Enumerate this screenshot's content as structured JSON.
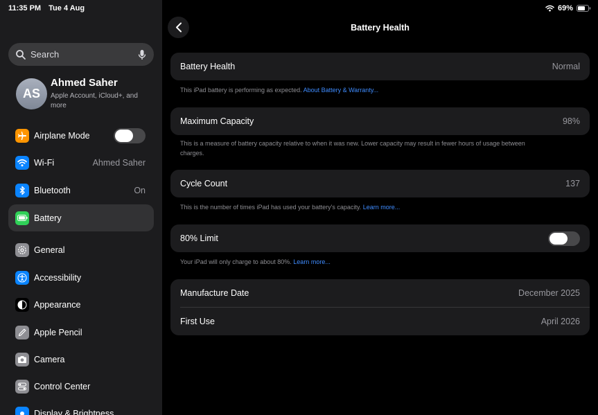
{
  "status": {
    "time": "11:35 PM",
    "date": "Tue 4 Aug",
    "battery_pct": "69%"
  },
  "search": {
    "placeholder": "Search"
  },
  "profile": {
    "initials": "AS",
    "name": "Ahmed Saher",
    "subtitle": "Apple Account, iCloud+, and more"
  },
  "sidebar": {
    "items": [
      {
        "label": "Airplane Mode",
        "icon": "airplane-icon",
        "color": "#ff9500"
      },
      {
        "label": "Wi-Fi",
        "value": "Ahmed Saher",
        "icon": "wifi-icon",
        "color": "#0a84ff"
      },
      {
        "label": "Bluetooth",
        "value": "On",
        "icon": "bluetooth-icon",
        "color": "#0a84ff"
      },
      {
        "label": "Battery",
        "icon": "battery-icon",
        "color": "#30d158"
      },
      {
        "label": "General",
        "icon": "gear-icon",
        "color": "#8e8e93"
      },
      {
        "label": "Accessibility",
        "icon": "accessibility-icon",
        "color": "#0a84ff"
      },
      {
        "label": "Appearance",
        "icon": "appearance-icon",
        "color": "#000000"
      },
      {
        "label": "Apple Pencil",
        "icon": "pencil-icon",
        "color": "#8e8e93"
      },
      {
        "label": "Camera",
        "icon": "camera-icon",
        "color": "#8e8e93"
      },
      {
        "label": "Control Center",
        "icon": "control-center-icon",
        "color": "#8e8e93"
      },
      {
        "label": "Display & Brightness",
        "icon": "display-icon",
        "color": "#0a84ff"
      }
    ]
  },
  "main": {
    "title": "Battery Health",
    "health": {
      "label": "Battery Health",
      "value": "Normal",
      "note": "This iPad battery is performing as expected.",
      "note_link": "About Battery & Warranty..."
    },
    "capacity": {
      "label": "Maximum Capacity",
      "value": "98%",
      "note": "This is a measure of battery capacity relative to when it was new. Lower capacity may result in fewer hours of usage between charges."
    },
    "cycles": {
      "label": "Cycle Count",
      "value": "137",
      "note": "This is the number of times iPad has used your battery's capacity.",
      "note_link": "Learn more..."
    },
    "limit": {
      "label": "80% Limit",
      "note": "Your iPad will only charge to about 80%.",
      "note_link": "Learn more..."
    },
    "dates": {
      "manufacture_label": "Manufacture Date",
      "manufacture_value": "December 2025",
      "first_use_label": "First Use",
      "first_use_value": "April 2026"
    }
  }
}
